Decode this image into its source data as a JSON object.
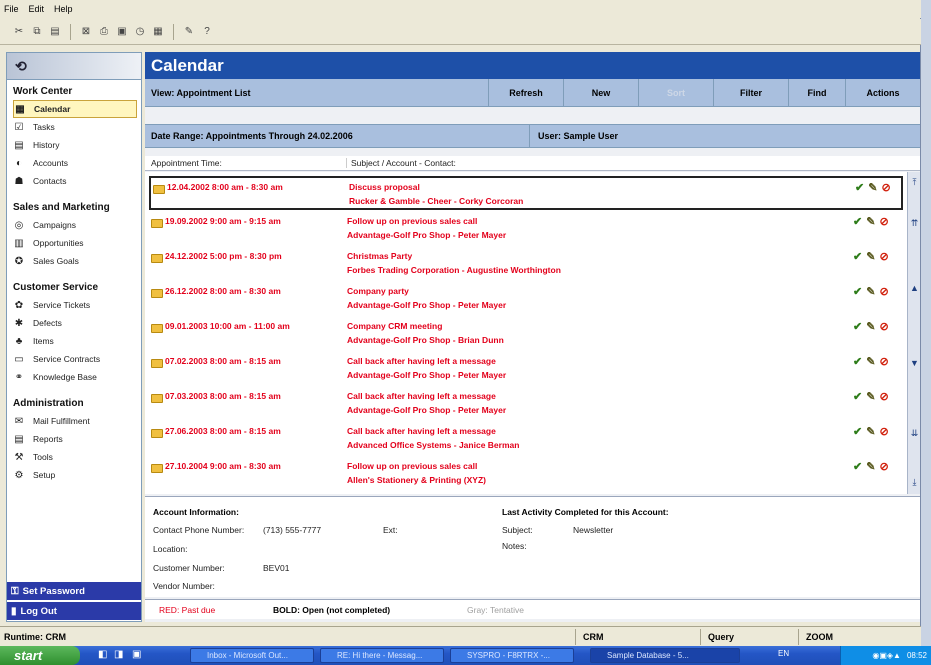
{
  "menu": [
    "File",
    "Edit",
    "Help"
  ],
  "title": "Calendar",
  "view": {
    "label": "View: Appointment List",
    "buttons": [
      "Refresh",
      "New",
      "Sort",
      "Filter",
      "Find",
      "Actions"
    ]
  },
  "range": {
    "label": "Date Range: Appointments Through 24.02.2006",
    "user": "User: Sample User"
  },
  "columns": [
    "Appointment Time:",
    "Subject / Account - Contact:"
  ],
  "sidebar": {
    "sections": [
      {
        "title": "Work Center",
        "items": [
          {
            "label": "Calendar",
            "icon": "calendar-icon",
            "active": true
          },
          {
            "label": "Tasks",
            "icon": "tasks-icon"
          },
          {
            "label": "History",
            "icon": "history-icon"
          },
          {
            "label": "Accounts",
            "icon": "accounts-icon"
          },
          {
            "label": "Contacts",
            "icon": "contacts-icon"
          }
        ]
      },
      {
        "title": "Sales and Marketing",
        "items": [
          {
            "label": "Campaigns",
            "icon": "campaigns-icon"
          },
          {
            "label": "Opportunities",
            "icon": "opportunities-icon"
          },
          {
            "label": "Sales Goals",
            "icon": "sales-goals-icon"
          }
        ]
      },
      {
        "title": "Customer Service",
        "items": [
          {
            "label": "Service Tickets",
            "icon": "service-tickets-icon"
          },
          {
            "label": "Defects",
            "icon": "defects-icon"
          },
          {
            "label": "Items",
            "icon": "items-icon"
          },
          {
            "label": "Service Contracts",
            "icon": "service-contracts-icon"
          },
          {
            "label": "Knowledge Base",
            "icon": "knowledge-base-icon"
          }
        ]
      },
      {
        "title": "Administration",
        "items": [
          {
            "label": "Mail Fulfillment",
            "icon": "mail-fulfillment-icon"
          },
          {
            "label": "Reports",
            "icon": "reports-icon"
          },
          {
            "label": "Tools",
            "icon": "tools-icon"
          },
          {
            "label": "Setup",
            "icon": "setup-icon"
          }
        ]
      }
    ],
    "set_password": "Set Password",
    "log_out": "Log Out"
  },
  "appointments": [
    {
      "time": "12.04.2002  8:00 am  -  8:30 am",
      "subject": "Discuss proposal",
      "account": "Rucker & Gamble - Cheer - Corky Corcoran"
    },
    {
      "time": "19.09.2002  9:00 am  -  9:15 am",
      "subject": "Follow up on previous sales call",
      "account": "Advantage-Golf Pro Shop - Peter Mayer"
    },
    {
      "time": "24.12.2002  5:00 pm  -  8:30 pm",
      "subject": "Christmas Party",
      "account": "Forbes Trading Corporation - Augustine Worthington"
    },
    {
      "time": "26.12.2002  8:00 am  -  8:30 am",
      "subject": "Company party",
      "account": "Advantage-Golf Pro Shop - Peter Mayer"
    },
    {
      "time": "09.01.2003 10:00 am  -  11:00 am",
      "subject": "Company CRM meeting",
      "account": "Advantage-Golf Pro Shop - Brian Dunn"
    },
    {
      "time": "07.02.2003  8:00 am  -  8:15 am",
      "subject": "Call back after having left a message",
      "account": "Advantage-Golf Pro Shop - Peter Mayer"
    },
    {
      "time": "07.03.2003  8:00 am  -  8:15 am",
      "subject": "Call back after having left a message",
      "account": "Advantage-Golf Pro Shop - Peter Mayer"
    },
    {
      "time": "27.06.2003  8:00 am  -  8:15 am",
      "subject": "Call back after having left a message",
      "account": "Advanced Office Systems - Janice Berman"
    },
    {
      "time": "27.10.2004  9:00 am  -  8:30 am",
      "subject": "Follow up on previous sales call",
      "account": "Allen's Stationery & Printing (XYZ)"
    }
  ],
  "account_info": {
    "title": "Account Information:",
    "phone_label": "Contact Phone Number:",
    "phone": "(713) 555-7777",
    "ext_label": "Ext:",
    "location_label": "Location:",
    "customer_label": "Customer Number:",
    "customer": "BEV01",
    "vendor_label": "Vendor Number:"
  },
  "last_activity": {
    "title": "Last Activity Completed for this Account:",
    "subject_label": "Subject:",
    "subject": "Newsletter",
    "notes_label": "Notes:"
  },
  "legend": {
    "red": "RED: Past due",
    "bold": "BOLD: Open (not completed)",
    "gray": "Gray: Tentative"
  },
  "status": {
    "runtime": "Runtime: CRM",
    "crm": "CRM",
    "query": "Query",
    "zoom": "ZOOM"
  },
  "taskbar": {
    "start": "start",
    "tasks": [
      "Inbox - Microsoft Out...",
      "RE: Hi there - Messag...",
      "SYSPRO - F8RTRX -...",
      "Sample Database - 5..."
    ],
    "lang": "EN",
    "clock": "08:52"
  },
  "colors": {
    "title_blue": "#1e50a8",
    "past_due_red": "#e3001b",
    "header_blue": "#a9bfde"
  }
}
